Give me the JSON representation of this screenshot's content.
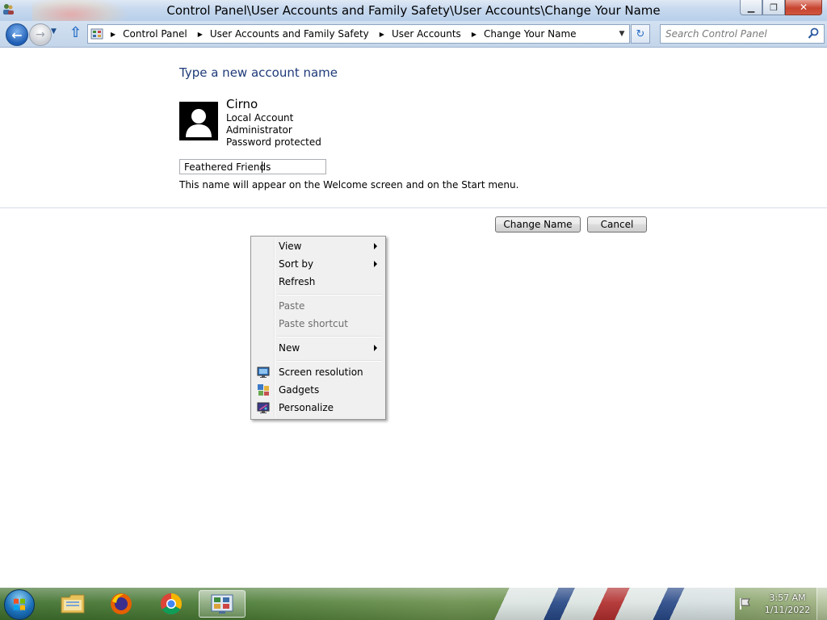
{
  "window": {
    "title": "Control Panel\\User Accounts and Family Safety\\User Accounts\\Change Your Name",
    "buttons": {
      "minimize": "▁",
      "maximize": "❐",
      "close": "✕"
    }
  },
  "navigation": {
    "breadcrumbs": [
      "Control Panel",
      "User Accounts and Family Safety",
      "User Accounts",
      "Change Your Name"
    ],
    "search_placeholder": "Search Control Panel"
  },
  "page": {
    "heading": "Type a new account name",
    "account": {
      "name": "Cirno",
      "type": "Local Account",
      "role": "Administrator",
      "password_status": "Password protected"
    },
    "name_field_value": "Feathered Friends",
    "hint": "This name will appear on the Welcome screen and on the Start menu.",
    "buttons": {
      "change_name": "Change Name",
      "cancel": "Cancel"
    }
  },
  "context_menu": {
    "items": [
      {
        "label": "View",
        "submenu": true,
        "enabled": true
      },
      {
        "label": "Sort by",
        "submenu": true,
        "enabled": true
      },
      {
        "label": "Refresh",
        "enabled": true
      },
      {
        "label": "Paste",
        "enabled": false
      },
      {
        "label": "Paste shortcut",
        "enabled": false
      },
      {
        "label": "New",
        "submenu": true,
        "enabled": true
      },
      {
        "label": "Screen resolution",
        "icon": "monitor-icon",
        "enabled": true
      },
      {
        "label": "Gadgets",
        "icon": "gadgets-icon",
        "enabled": true
      },
      {
        "label": "Personalize",
        "icon": "personalize-icon",
        "enabled": true
      }
    ]
  },
  "taskbar": {
    "apps": [
      "file-explorer-icon",
      "firefox-icon",
      "chrome-icon",
      "control-panel-icon"
    ],
    "active_app": "control-panel-icon",
    "clock": {
      "time": "3:57 AM",
      "date": "1/11/2022"
    }
  },
  "colors": {
    "heading": "#1e3a78",
    "title_bar": "#c6d8ee",
    "close_button": "#c7442f"
  }
}
